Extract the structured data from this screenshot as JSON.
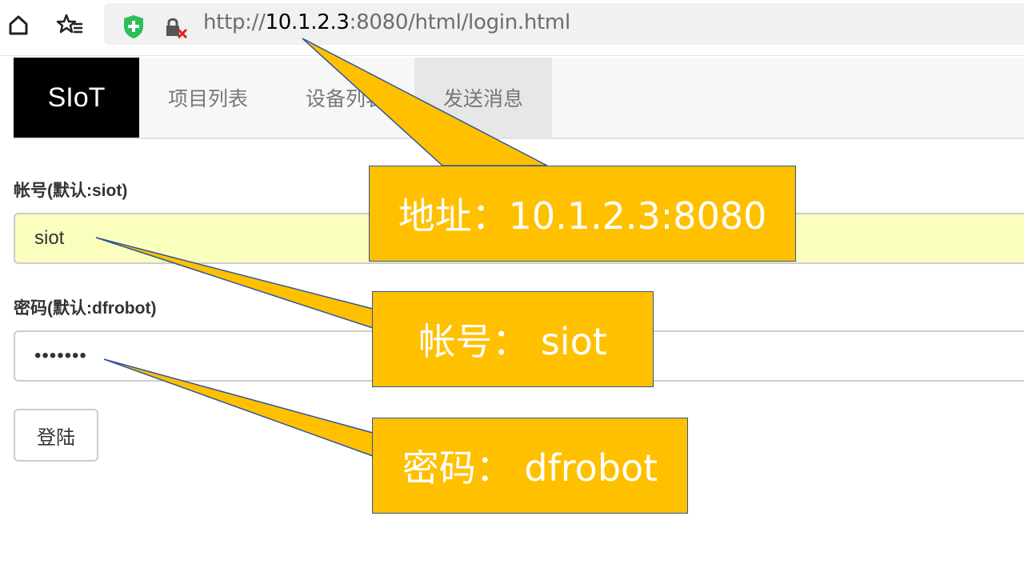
{
  "browser": {
    "url_prefix": "http://",
    "url_host": "10.1.2.3",
    "url_rest": ":8080/html/login.html"
  },
  "navbar": {
    "brand": "SIoT",
    "items": [
      {
        "label": "项目列表"
      },
      {
        "label": "设备列表"
      },
      {
        "label": "发送消息"
      }
    ]
  },
  "form": {
    "username_label": "帐号(默认:siot)",
    "username_value": "siot",
    "password_label": "密码(默认:dfrobot)",
    "password_value": "•••••••",
    "submit_label": "登陆"
  },
  "callouts": {
    "address": "地址：10.1.2.3:8080",
    "account": "帐号： siot",
    "password": "密码： dfrobot"
  },
  "colors": {
    "callout_fill": "#ffc000",
    "callout_border": "#2f5597",
    "autofill_bg": "#faffbd",
    "brand_bg": "#000000"
  }
}
